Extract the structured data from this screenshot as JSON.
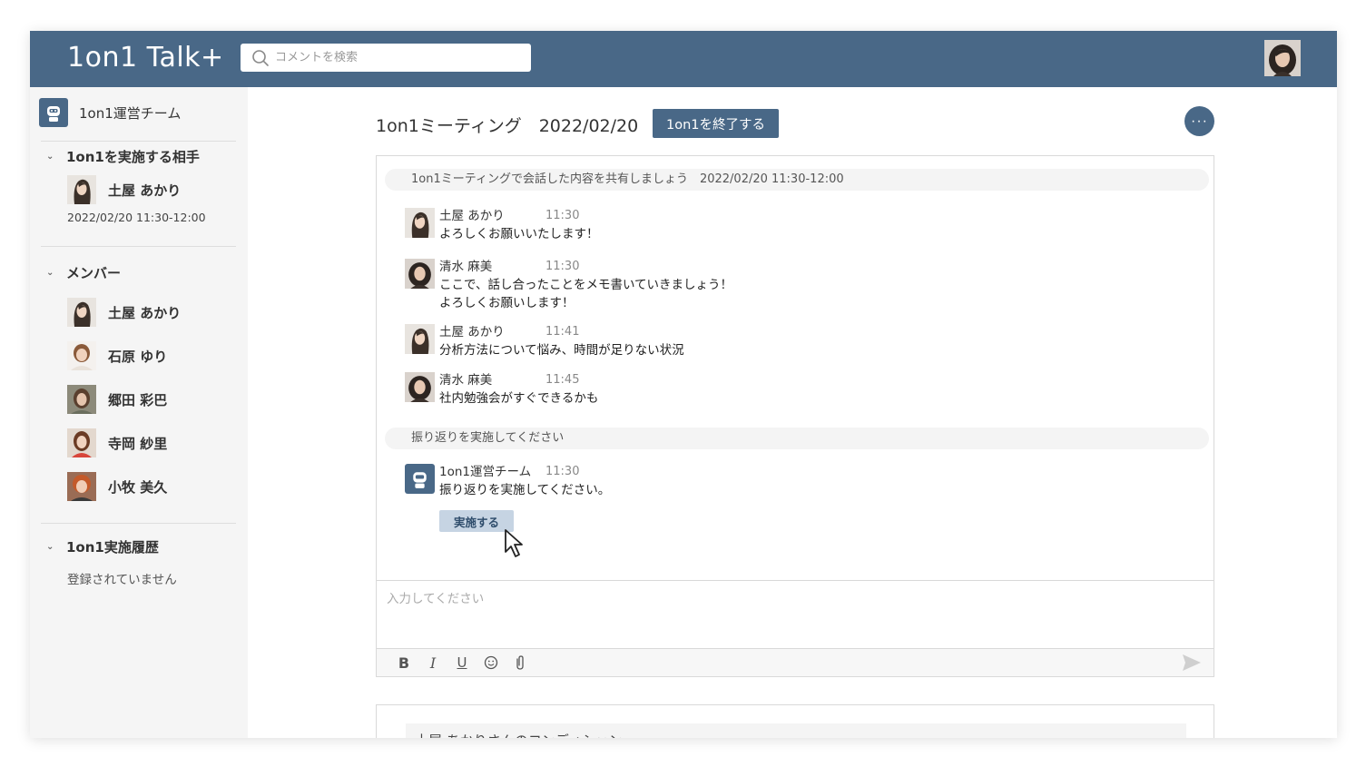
{
  "app": {
    "title": "1on1 Talk+"
  },
  "search": {
    "placeholder": "コメントを検索"
  },
  "sidebar": {
    "team": "1on1運営チーム",
    "partner_section": {
      "title": "1on1を実施する相手",
      "name": "土屋 あかり",
      "datetime": "2022/02/20 11:30-12:00"
    },
    "members_section": {
      "title": "メンバー",
      "members": [
        "土屋 あかり",
        "石原 ゆり",
        "郷田 彩巴",
        "寺岡 紗里",
        "小牧 美久"
      ]
    },
    "history_section": {
      "title": "1on1実施履歴",
      "empty_text": "登録されていません"
    }
  },
  "main": {
    "title": "1on1ミーティング　2022/02/20",
    "end_button": "1on1を終了する",
    "more_button": "···",
    "banner1": "1on1ミーティングで会話した内容を共有しましょう　2022/02/20 11:30-12:00",
    "messages": [
      {
        "name": "土屋 あかり",
        "time": "11:30",
        "text": "よろしくお願いいたします！"
      },
      {
        "name": "清水 麻美",
        "time": "11:30",
        "text": "ここで、話し合ったことをメモ書いていきましょう！\nよろしくお願いします！"
      },
      {
        "name": "土屋 あかり",
        "time": "11:41",
        "text": "分析方法について悩み、時間が足りない状況"
      },
      {
        "name": "清水 麻美",
        "time": "11:45",
        "text": "社内勉強会がすぐできるかも"
      }
    ],
    "banner2": "振り返りを実施してください",
    "bot_message": {
      "name": "1on1運営チーム",
      "time": "11:30",
      "text": "振り返りを実施してください。"
    },
    "action_button": "実施する",
    "input_placeholder": "入力してください",
    "toolbar": {
      "bold": "B",
      "italic": "I",
      "underline": "U"
    },
    "next_card_title": "土屋 あかりさんのコンディション"
  },
  "colors": {
    "header": "#496887",
    "accent_button": "#496887",
    "action_button": "#c6d4e3",
    "sidebar_bg": "#f5f5f5"
  },
  "icons": [
    "search-icon",
    "robot-icon",
    "chevron-down-icon",
    "more-icon",
    "bold-icon",
    "italic-icon",
    "underline-icon",
    "emoji-icon",
    "attachment-icon",
    "send-icon",
    "cursor-icon"
  ]
}
